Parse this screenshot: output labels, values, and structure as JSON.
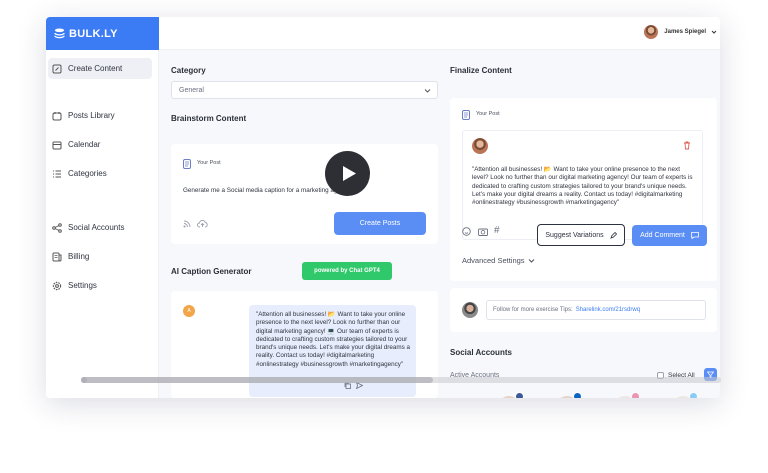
{
  "app": {
    "name": "BULK.LY",
    "brand_color": "#3b7cf4"
  },
  "user": {
    "name": "James Spiegel"
  },
  "sidebar": {
    "items": [
      {
        "label": "Create Content",
        "icon": "pencil-square-icon",
        "active": true
      },
      {
        "label": "Posts Library",
        "icon": "calendar-library-icon"
      },
      {
        "label": "Calendar",
        "icon": "calendar-icon"
      },
      {
        "label": "Categories",
        "icon": "list-icon"
      },
      {
        "label": "Social Accounts",
        "icon": "share-icon"
      },
      {
        "label": "Billing",
        "icon": "billing-icon"
      },
      {
        "label": "Settings",
        "icon": "gear-icon"
      }
    ]
  },
  "left": {
    "category_heading": "Category",
    "category_value": "General",
    "brainstorm_heading": "Brainstorm Content",
    "your_post_label": "Your Post",
    "prompt_text": "Generate me a Social media caption for a marketing agency",
    "create_button": "Create Posts",
    "ai_heading": "AI Caption Generator",
    "ai_badge": "powered by Chat GPT4",
    "chat_avatar_letter": "A",
    "chat_text": "\"Attention all businesses! 📂 Want to take your online presence to the next level? Look no further than our digital marketing agency! 💻 Our team of experts is dedicated to crafting custom strategies tailored to your brand's unique needs. Let's make your digital dreams a reality. Contact us today! #digitalmarketing #onlinestrategy #businessgrowth #marketingagency\""
  },
  "right": {
    "finalize_heading": "Finalize Content",
    "your_post_label": "Your Post",
    "post_text": "\"Attention all businesses! 📂 Want to take your online presence to the next level? Look no further than our digital marketing agency! Our team of experts is dedicated to crafting custom strategies tailored to your brand's unique needs. Let's make your digital dreams a reality. Contact us today! #digitalmarketing #onlinestrategy #businessgrowth #marketingagency\"",
    "suggest_button": "Suggest Variations",
    "add_comment_button": "Add Comment",
    "advanced_settings": "Advanced Settings",
    "comment_placeholder": "Follow for more exercise Tips:",
    "comment_link": "Sharelink.com/21rsdrwq",
    "social_heading": "Social Accounts",
    "active_accounts_label": "Active Accounts",
    "select_all_label": "Select All"
  },
  "video": {
    "progress": 0.55
  }
}
